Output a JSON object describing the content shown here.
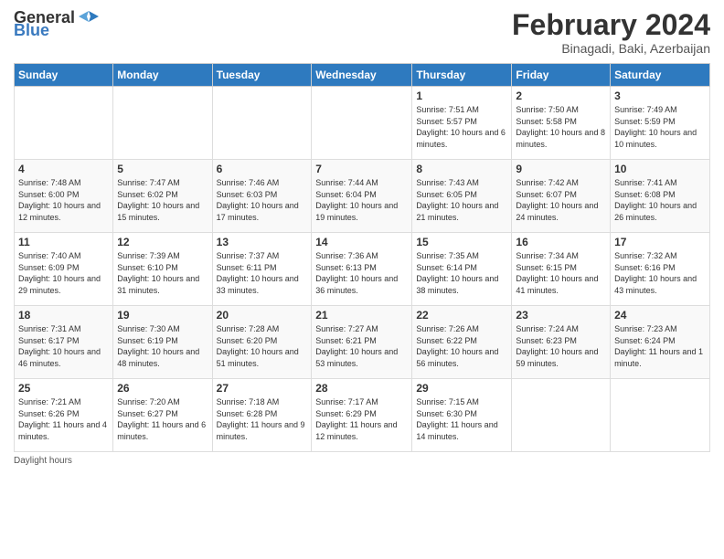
{
  "header": {
    "logo_general": "General",
    "logo_blue": "Blue",
    "title": "February 2024",
    "subtitle": "Binagadi, Baki, Azerbaijan"
  },
  "columns": [
    "Sunday",
    "Monday",
    "Tuesday",
    "Wednesday",
    "Thursday",
    "Friday",
    "Saturday"
  ],
  "weeks": [
    [
      {
        "day": "",
        "info": ""
      },
      {
        "day": "",
        "info": ""
      },
      {
        "day": "",
        "info": ""
      },
      {
        "day": "",
        "info": ""
      },
      {
        "day": "1",
        "info": "Sunrise: 7:51 AM\nSunset: 5:57 PM\nDaylight: 10 hours and 6 minutes."
      },
      {
        "day": "2",
        "info": "Sunrise: 7:50 AM\nSunset: 5:58 PM\nDaylight: 10 hours and 8 minutes."
      },
      {
        "day": "3",
        "info": "Sunrise: 7:49 AM\nSunset: 5:59 PM\nDaylight: 10 hours and 10 minutes."
      }
    ],
    [
      {
        "day": "4",
        "info": "Sunrise: 7:48 AM\nSunset: 6:00 PM\nDaylight: 10 hours and 12 minutes."
      },
      {
        "day": "5",
        "info": "Sunrise: 7:47 AM\nSunset: 6:02 PM\nDaylight: 10 hours and 15 minutes."
      },
      {
        "day": "6",
        "info": "Sunrise: 7:46 AM\nSunset: 6:03 PM\nDaylight: 10 hours and 17 minutes."
      },
      {
        "day": "7",
        "info": "Sunrise: 7:44 AM\nSunset: 6:04 PM\nDaylight: 10 hours and 19 minutes."
      },
      {
        "day": "8",
        "info": "Sunrise: 7:43 AM\nSunset: 6:05 PM\nDaylight: 10 hours and 21 minutes."
      },
      {
        "day": "9",
        "info": "Sunrise: 7:42 AM\nSunset: 6:07 PM\nDaylight: 10 hours and 24 minutes."
      },
      {
        "day": "10",
        "info": "Sunrise: 7:41 AM\nSunset: 6:08 PM\nDaylight: 10 hours and 26 minutes."
      }
    ],
    [
      {
        "day": "11",
        "info": "Sunrise: 7:40 AM\nSunset: 6:09 PM\nDaylight: 10 hours and 29 minutes."
      },
      {
        "day": "12",
        "info": "Sunrise: 7:39 AM\nSunset: 6:10 PM\nDaylight: 10 hours and 31 minutes."
      },
      {
        "day": "13",
        "info": "Sunrise: 7:37 AM\nSunset: 6:11 PM\nDaylight: 10 hours and 33 minutes."
      },
      {
        "day": "14",
        "info": "Sunrise: 7:36 AM\nSunset: 6:13 PM\nDaylight: 10 hours and 36 minutes."
      },
      {
        "day": "15",
        "info": "Sunrise: 7:35 AM\nSunset: 6:14 PM\nDaylight: 10 hours and 38 minutes."
      },
      {
        "day": "16",
        "info": "Sunrise: 7:34 AM\nSunset: 6:15 PM\nDaylight: 10 hours and 41 minutes."
      },
      {
        "day": "17",
        "info": "Sunrise: 7:32 AM\nSunset: 6:16 PM\nDaylight: 10 hours and 43 minutes."
      }
    ],
    [
      {
        "day": "18",
        "info": "Sunrise: 7:31 AM\nSunset: 6:17 PM\nDaylight: 10 hours and 46 minutes."
      },
      {
        "day": "19",
        "info": "Sunrise: 7:30 AM\nSunset: 6:19 PM\nDaylight: 10 hours and 48 minutes."
      },
      {
        "day": "20",
        "info": "Sunrise: 7:28 AM\nSunset: 6:20 PM\nDaylight: 10 hours and 51 minutes."
      },
      {
        "day": "21",
        "info": "Sunrise: 7:27 AM\nSunset: 6:21 PM\nDaylight: 10 hours and 53 minutes."
      },
      {
        "day": "22",
        "info": "Sunrise: 7:26 AM\nSunset: 6:22 PM\nDaylight: 10 hours and 56 minutes."
      },
      {
        "day": "23",
        "info": "Sunrise: 7:24 AM\nSunset: 6:23 PM\nDaylight: 10 hours and 59 minutes."
      },
      {
        "day": "24",
        "info": "Sunrise: 7:23 AM\nSunset: 6:24 PM\nDaylight: 11 hours and 1 minute."
      }
    ],
    [
      {
        "day": "25",
        "info": "Sunrise: 7:21 AM\nSunset: 6:26 PM\nDaylight: 11 hours and 4 minutes."
      },
      {
        "day": "26",
        "info": "Sunrise: 7:20 AM\nSunset: 6:27 PM\nDaylight: 11 hours and 6 minutes."
      },
      {
        "day": "27",
        "info": "Sunrise: 7:18 AM\nSunset: 6:28 PM\nDaylight: 11 hours and 9 minutes."
      },
      {
        "day": "28",
        "info": "Sunrise: 7:17 AM\nSunset: 6:29 PM\nDaylight: 11 hours and 12 minutes."
      },
      {
        "day": "29",
        "info": "Sunrise: 7:15 AM\nSunset: 6:30 PM\nDaylight: 11 hours and 14 minutes."
      },
      {
        "day": "",
        "info": ""
      },
      {
        "day": "",
        "info": ""
      }
    ]
  ],
  "footer": {
    "daylight_label": "Daylight hours"
  }
}
